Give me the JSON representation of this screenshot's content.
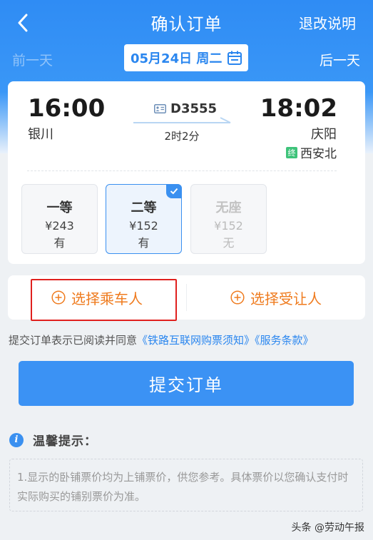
{
  "header": {
    "title": "确认订单",
    "refund_link": "退改说明",
    "prev_day": "前一天",
    "next_day": "后一天",
    "date": "05月24日 周二"
  },
  "trip": {
    "depart_time": "16:00",
    "depart_station": "银川",
    "arrive_time": "18:02",
    "arrive_station": "庆阳",
    "terminal_badge": "终",
    "terminal_station": "西安北",
    "train_no": "D3555",
    "duration": "2时2分"
  },
  "seats": [
    {
      "name": "一等",
      "price": "¥243",
      "availability": "有",
      "state": "normal"
    },
    {
      "name": "二等",
      "price": "¥152",
      "availability": "有",
      "state": "selected"
    },
    {
      "name": "无座",
      "price": "¥152",
      "availability": "无",
      "state": "disabled"
    }
  ],
  "passengers": {
    "select_passenger": "选择乘车人",
    "select_yield": "选择受让人"
  },
  "agreement": {
    "prefix": "提交订单表示已阅读并同意",
    "link1": "《铁路互联网购票须知》",
    "link2": "《服务条款》"
  },
  "submit_label": "提交订单",
  "tips": {
    "icon": "i",
    "title": "温馨提示：",
    "text": "1.显示的卧铺票价均为上铺票价，供您参考。具体票价以您确认支付时实际购买的铺别票价为准。"
  },
  "watermark": "头条 @劳动午报",
  "colors": {
    "primary": "#3b92f4",
    "accent_orange": "#ef7b1e",
    "highlight_red": "#e0201e",
    "terminal_green": "#3ec37a"
  }
}
